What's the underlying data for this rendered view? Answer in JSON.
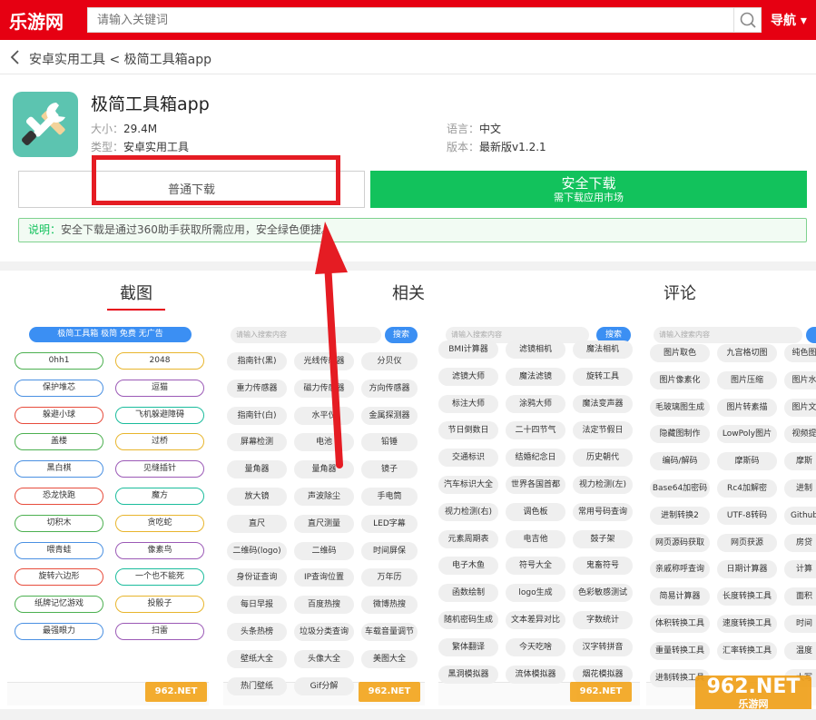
{
  "header": {
    "logo": "乐游网",
    "search_placeholder": "请输入关键词",
    "nav_label": "导航 ▾",
    "brand_color": "#e60012"
  },
  "breadcrumb": {
    "text": "安卓实用工具 < 极简工具箱app"
  },
  "app": {
    "title": "极简工具箱app",
    "size_label": "大小：",
    "size_value": "29.4M",
    "type_label": "类型：",
    "type_value": "安卓实用工具",
    "lang_label": "语言：",
    "lang_value": "中文",
    "version_label": "版本：",
    "version_value": "最新版v1.2.1"
  },
  "buttons": {
    "normal_download": "普通下载",
    "safe_download": "安全下载",
    "safe_download_sub": "需下载应用市场"
  },
  "note": {
    "prefix": "说明：",
    "text": "安全下载是通过360助手获取所需应用，安全绿色便捷。"
  },
  "tabs": [
    "截图",
    "相关",
    "评论"
  ],
  "screenshot1": {
    "banner": "极简工具箱 极简 免费 无广告",
    "rows": [
      [
        "0hh1",
        "2048"
      ],
      [
        "保护堆芯",
        "逗猫"
      ],
      [
        "躲避小球",
        "飞机躲避障碍"
      ],
      [
        "盖楼",
        "过桥"
      ],
      [
        "黑白棋",
        "见缝插针"
      ],
      [
        "恐龙快跑",
        "魔方"
      ],
      [
        "切积木",
        "贪吃蛇"
      ],
      [
        "喂青蛙",
        "像素鸟"
      ],
      [
        "旋转六边形",
        "一个也不能死"
      ],
      [
        "纸牌记忆游戏",
        "投骰子"
      ],
      [
        "最强眼力",
        "扫雷"
      ]
    ],
    "pill_colors": [
      "#4cb050",
      "#e8b52c",
      "#4a90e2",
      "#9b59b6",
      "#e74c3c",
      "#1abc9c"
    ]
  },
  "screenshot2": {
    "search_placeholder": "请输入搜索内容",
    "search_button": "搜索",
    "rows": [
      [
        "指南针(黑)",
        "光线传感器",
        "分贝仪"
      ],
      [
        "重力传感器",
        "磁力传感器",
        "方向传感器"
      ],
      [
        "指南针(白)",
        "水平仪",
        "金属探测器"
      ],
      [
        "屏幕检测",
        "电池",
        "铅锤"
      ],
      [
        "量角器",
        "量角器",
        "镜子"
      ],
      [
        "放大镜",
        "声波除尘",
        "手电筒"
      ],
      [
        "直尺",
        "直尺测量",
        "LED字幕"
      ],
      [
        "二维码(logo)",
        "二维码",
        "时间屏保"
      ],
      [
        "身份证查询",
        "IP查询位置",
        "万年历"
      ],
      [
        "每日早报",
        "百度热搜",
        "微博热搜"
      ],
      [
        "头条热榜",
        "垃圾分类查询",
        "车载音量调节"
      ],
      [
        "壁纸大全",
        "头像大全",
        "美图大全"
      ],
      [
        "热门壁纸",
        "Gif分解",
        ""
      ]
    ]
  },
  "screenshot3": {
    "search_placeholder": "请输入搜索内容",
    "search_button": "搜索",
    "rows": [
      [
        "BMI计算器",
        "滤镜相机",
        "魔法相机"
      ],
      [
        "滤镜大师",
        "魔法滤镜",
        "旋转工具"
      ],
      [
        "标注大师",
        "涂鸦大师",
        "魔法变声器"
      ],
      [
        "节日倒数日",
        "二十四节气",
        "法定节假日"
      ],
      [
        "交通标识",
        "结婚纪念日",
        "历史朝代"
      ],
      [
        "汽车标识大全",
        "世界各国首都",
        "视力检测(左)"
      ],
      [
        "视力检测(右)",
        "调色板",
        "常用号码查询"
      ],
      [
        "元素周期表",
        "电吉他",
        "鼓子架"
      ],
      [
        "电子木鱼",
        "符号大全",
        "鬼畜符号"
      ],
      [
        "函数绘制",
        "logo生成",
        "色彩敏感测试"
      ],
      [
        "随机密码生成",
        "文本差异对比",
        "字数统计"
      ],
      [
        "繁体翻译",
        "今天吃啥",
        "汉字转拼音"
      ],
      [
        "黑洞模拟器",
        "流体模拟器",
        "烟花模拟器"
      ]
    ]
  },
  "screenshot4": {
    "search_placeholder": "请输入搜索内容",
    "rows": [
      [
        "图片取色",
        "九宫格切图",
        "纯色图"
      ],
      [
        "图片像素化",
        "图片压缩",
        "图片水"
      ],
      [
        "毛玻璃图生成",
        "图片转素描",
        "图片文"
      ],
      [
        "隐藏图制作",
        "LowPoly图片",
        "视频提"
      ],
      [
        "编码/解码",
        "摩斯码",
        "摩斯"
      ],
      [
        "Base64加密码",
        "Rc4加解密",
        "进制"
      ],
      [
        "进制转换2",
        "UTF-8转码",
        "Github"
      ],
      [
        "网页源码获取",
        "网页获源",
        "房贷"
      ],
      [
        "亲戚称呼查询",
        "日期计算器",
        "计算"
      ],
      [
        "简易计算器",
        "长度转换工具",
        "面积"
      ],
      [
        "体积转换工具",
        "速度转换工具",
        "时间"
      ],
      [
        "重量转换工具",
        "汇率转换工具",
        "温度"
      ],
      [
        "进制转换工具",
        "",
        "大写"
      ]
    ]
  },
  "watermark": {
    "brand": "962.NET",
    "sub": "乐游网"
  }
}
